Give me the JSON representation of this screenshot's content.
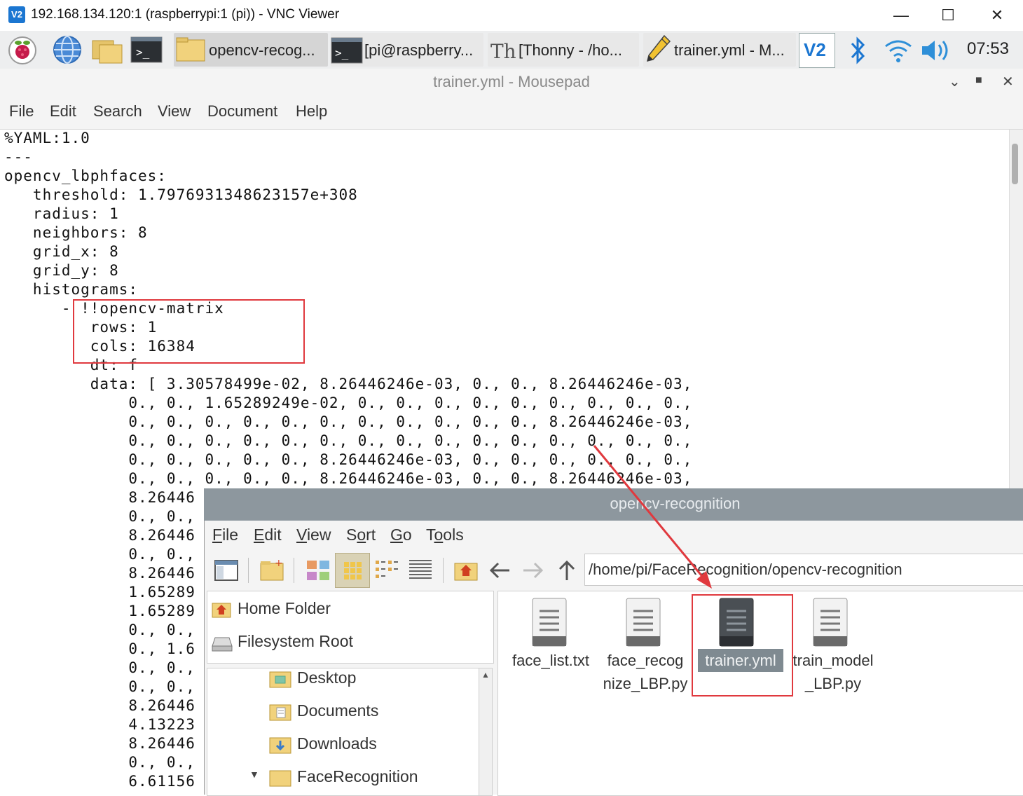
{
  "vnc": {
    "logo": "V2",
    "title": "192.168.134.120:1 (raspberrypi:1 (pi)) - VNC Viewer",
    "controls": [
      "—",
      "☐",
      "✕"
    ]
  },
  "taskbar": {
    "tasks": [
      {
        "label": "opencv-recog...",
        "icon": "folder-icon"
      },
      {
        "label": "[pi@raspberry...",
        "icon": "terminal-icon"
      },
      {
        "label": "[Thonny  -  /ho...",
        "icon": "thonny-icon"
      },
      {
        "label": "trainer.yml - M...",
        "icon": "pencil-icon"
      }
    ],
    "tray_icons": [
      "vnc-server-icon",
      "bluetooth-icon",
      "wifi-icon",
      "volume-icon"
    ],
    "clock": "07:53"
  },
  "mousepad": {
    "title": "trainer.yml - Mousepad",
    "menu": [
      "File",
      "Edit",
      "Search",
      "View",
      "Document",
      "Help"
    ],
    "lines": [
      "%YAML:1.0",
      "---",
      "opencv_lbphfaces:",
      "   threshold: 1.7976931348623157e+308",
      "   radius: 1",
      "   neighbors: 8",
      "   grid_x: 8",
      "   grid_y: 8",
      "   histograms:",
      "      - !!opencv-matrix",
      "         rows: 1",
      "         cols: 16384",
      "         dt: f",
      "         data: [ 3.30578499e-02, 8.26446246e-03, 0., 0., 8.26446246e-03,",
      "             0., 0., 1.65289249e-02, 0., 0., 0., 0., 0., 0., 0., 0., 0.,",
      "             0., 0., 0., 0., 0., 0., 0., 0., 0., 0., 0., 8.26446246e-03,",
      "             0., 0., 0., 0., 0., 0., 0., 0., 0., 0., 0., 0., 0., 0., 0.,",
      "             0., 0., 0., 0., 0., 8.26446246e-03, 0., 0., 0., 0., 0., 0.,",
      "             0., 0., 0., 0., 0., 8.26446246e-03, 0., 0., 8.26446246e-03,",
      "             8.26446",
      "             0., 0.,",
      "             8.26446",
      "             0., 0.,",
      "             8.26446",
      "             1.65289",
      "             1.65289",
      "             0., 0.,",
      "             0., 1.6",
      "             0., 0.,",
      "             0., 0.,",
      "             8.26446",
      "             4.13223",
      "             8.26446",
      "             0., 0.,",
      "             6.61156"
    ]
  },
  "file_manager": {
    "title": "opencv-recognition",
    "menu": [
      {
        "u": "F",
        "rest": "ile"
      },
      {
        "u": "E",
        "rest": "dit"
      },
      {
        "u": "V",
        "rest": "iew"
      },
      {
        "pre": "S",
        "u": "o",
        "rest": "rt"
      },
      {
        "u": "G",
        "rest": "o"
      },
      {
        "pre": "T",
        "u": "o",
        "rest": "ols"
      }
    ],
    "path": "/home/pi/FaceRecognition/opencv-recognition",
    "places": [
      "Home Folder",
      "Filesystem Root"
    ],
    "tree": [
      "Desktop",
      "Documents",
      "Downloads",
      "FaceRecognition"
    ],
    "files": [
      {
        "line1": "face_list.txt",
        "line2": ""
      },
      {
        "line1": "face_recog",
        "line2": "nize_LBP.py"
      },
      {
        "line1": "trainer.yml",
        "line2": ""
      },
      {
        "line1": "train_model",
        "line2": "_LBP.py"
      }
    ]
  },
  "colors": {
    "annotation_red": "#e0393e",
    "selection_bg": "#7f8a91",
    "fm_titlebar": "#8d979e"
  }
}
